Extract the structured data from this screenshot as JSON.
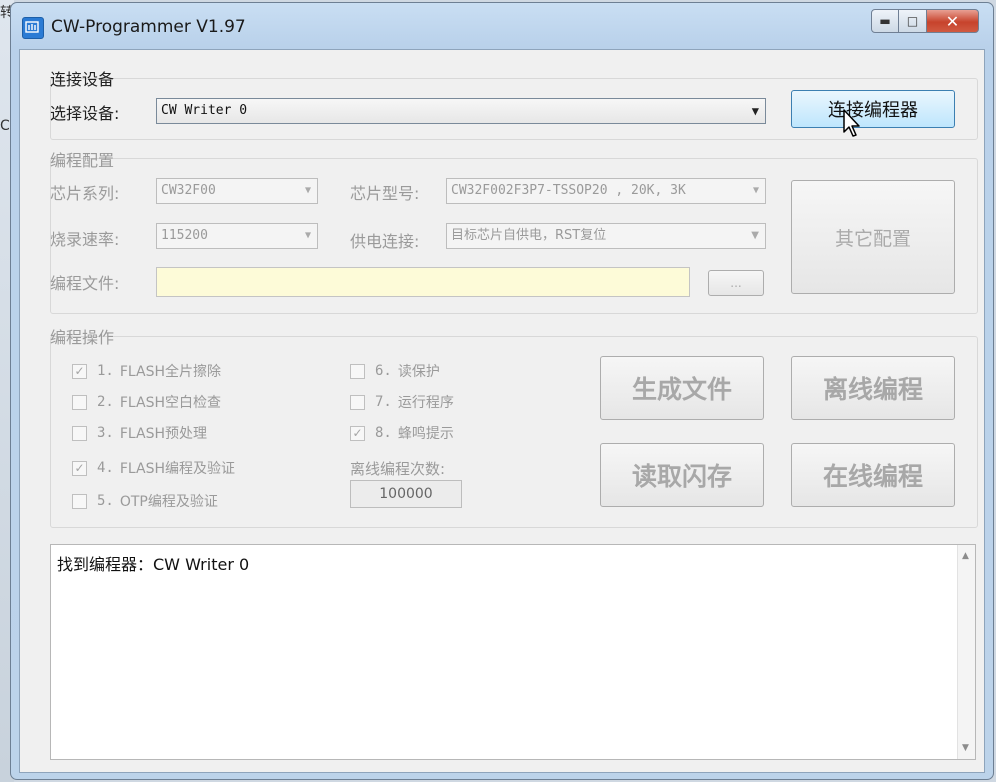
{
  "desktop": {
    "t1": "转",
    "t2": "C"
  },
  "window": {
    "title": "CW-Programmer V1.97"
  },
  "connect": {
    "group_title": "连接设备",
    "select_label": "选择设备:",
    "device_value": "CW Writer 0",
    "connect_button": "连接编程器"
  },
  "config": {
    "group_title": "编程配置",
    "chip_series_label": "芯片系列:",
    "chip_series_value": "CW32F00",
    "chip_model_label": "芯片型号:",
    "chip_model_value": "CW32F002F3P7-TSSOP20 , 20K, 3K",
    "baud_label": "烧录速率:",
    "baud_value": "115200",
    "power_label": "供电连接:",
    "power_value": "目标芯片自供电，RST复位",
    "file_label": "编程文件:",
    "file_value": "",
    "browse_button": "...",
    "other_config_button": "其它配置"
  },
  "ops": {
    "group_title": "编程操作",
    "options": [
      {
        "num": "1.",
        "label": "FLASH全片擦除",
        "checked": true
      },
      {
        "num": "2.",
        "label": "FLASH空白检查",
        "checked": false
      },
      {
        "num": "3.",
        "label": "FLASH预处理",
        "checked": false
      },
      {
        "num": "4.",
        "label": "FLASH编程及验证",
        "checked": true
      },
      {
        "num": "5.",
        "label": "OTP编程及验证",
        "checked": false
      },
      {
        "num": "6.",
        "label": "读保护",
        "checked": false
      },
      {
        "num": "7.",
        "label": "运行程序",
        "checked": false
      },
      {
        "num": "8.",
        "label": "蜂鸣提示",
        "checked": true
      }
    ],
    "offline_count_label": "离线编程次数:",
    "offline_count_value": "100000",
    "buttons": {
      "generate": "生成文件",
      "offline": "离线编程",
      "read": "读取闪存",
      "online": "在线编程"
    }
  },
  "log": {
    "text": "找到编程器：CW Writer 0"
  },
  "icons": [
    "app-icon",
    "minimize-icon",
    "maximize-icon",
    "close-icon",
    "dropdown-arrow-icon",
    "check-icon",
    "scroll-up-icon",
    "scroll-down-icon",
    "mouse-cursor-icon"
  ]
}
